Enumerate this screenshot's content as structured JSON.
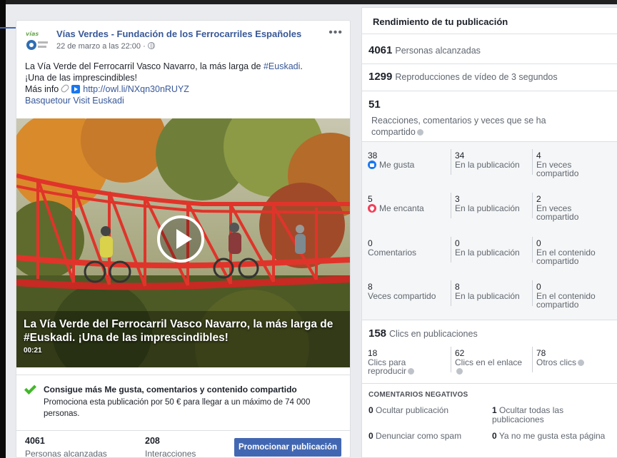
{
  "post": {
    "page_name": "Vías Verdes - Fundación de los Ferrocarriles Españoles",
    "logo_text": "vías verdes",
    "timestamp": "22 de marzo a las 22:00 ·",
    "more_icon": "more-horizontal-icon",
    "text": {
      "line1_prefix": "La Vía Verde del Ferrocarril Vasco Navarro, la más larga de ",
      "hashtag": "#Euskadi",
      "line1_suffix": ".",
      "line2": "¡Una de las imprescindibles!",
      "line3_prefix": "Más info",
      "url": "http://owl.li/NXqn30nRUYZ",
      "line4": "Basquetour Visit Euskadi"
    },
    "video": {
      "title": "La Vía Verde del Ferrocarril Vasco Navarro, la más larga de #Euskadi. ¡Una de las imprescindibles!",
      "duration": "00:21"
    },
    "promo": {
      "title": "Consigue más Me gusta, comentarios y contenido compartido",
      "description": "Promociona esta publicación por 50 € para llegar a un máximo de 74 000 personas."
    },
    "stats": {
      "reach_value": "4061",
      "reach_label": "Personas alcanzadas",
      "interactions_value": "208",
      "interactions_label": "Interacciones"
    },
    "promote_button": "Promocionar publicación"
  },
  "performance": {
    "title": "Rendimiento de tu publicación",
    "reach": {
      "value": "4061",
      "label": "Personas alcanzadas"
    },
    "views": {
      "value": "1299",
      "label": "Reproducciones de vídeo de 3 segundos"
    },
    "reactions": {
      "value": "51",
      "label": "Reacciones, comentarios y veces que se ha compartido"
    },
    "breakdown": [
      {
        "total": "38",
        "label": "Me gusta",
        "icon": "like-icon",
        "on_post": "34",
        "on_post_label": "En la publicación",
        "on_shares": "4",
        "on_shares_label": "En veces compartido"
      },
      {
        "total": "5",
        "label": "Me encanta",
        "icon": "love-icon",
        "on_post": "3",
        "on_post_label": "En la publicación",
        "on_shares": "2",
        "on_shares_label": "En veces compartido"
      },
      {
        "total": "0",
        "label": "Comentarios",
        "on_post": "0",
        "on_post_label": "En la publicación",
        "on_shares": "0",
        "on_shares_label": "En el contenido compartido"
      },
      {
        "total": "8",
        "label": "Veces compartido",
        "on_post": "8",
        "on_post_label": "En la publicación",
        "on_shares": "0",
        "on_shares_label": "En el contenido compartido"
      }
    ],
    "clicks": {
      "value": "158",
      "label": "Clics en publicaciones",
      "play": {
        "value": "18",
        "label": "Clics para reproducir"
      },
      "link": {
        "value": "62",
        "label": "Clics en el enlace"
      },
      "other": {
        "value": "78",
        "label": "Otros clics"
      }
    },
    "negative": {
      "title": "COMENTARIOS NEGATIVOS",
      "hide_post": {
        "value": "0",
        "label": "Ocultar publicación"
      },
      "hide_all": {
        "value": "1",
        "label": "Ocultar todas las publicaciones"
      },
      "spam": {
        "value": "0",
        "label": "Denunciar como spam"
      },
      "unlike": {
        "value": "0",
        "label": "Ya no me gusta esta página"
      }
    }
  },
  "colors": {
    "link": "#385898",
    "button": "#4267b2",
    "like": "#1877f2",
    "love": "#f33e58",
    "check": "#42b72a",
    "bridge": "#e0342a"
  }
}
